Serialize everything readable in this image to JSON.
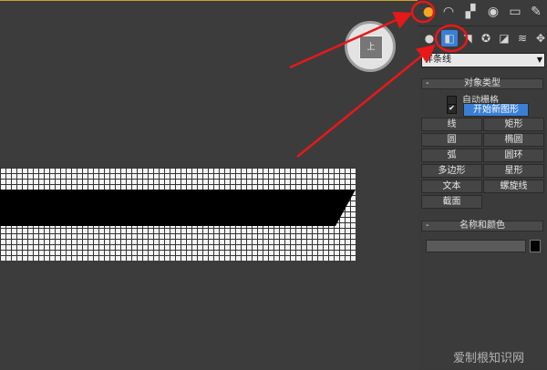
{
  "viewport": {
    "viewcube_label": "上"
  },
  "panel": {
    "tabs": [
      {
        "name": "create-tab",
        "glyph": "●"
      },
      {
        "name": "modify-tab",
        "glyph": "◠"
      },
      {
        "name": "hierarchy-tab",
        "glyph": "▞"
      },
      {
        "name": "motion-tab",
        "glyph": "◉"
      },
      {
        "name": "display-tab",
        "glyph": "▭"
      },
      {
        "name": "utilities-tab",
        "glyph": "✎"
      }
    ],
    "subcategories": [
      {
        "name": "geometry",
        "glyph": "●"
      },
      {
        "name": "shapes",
        "glyph": "◧"
      },
      {
        "name": "lights",
        "glyph": "◥"
      },
      {
        "name": "cameras",
        "glyph": "✪"
      },
      {
        "name": "helpers",
        "glyph": "◪"
      },
      {
        "name": "space-warps",
        "glyph": "≋"
      },
      {
        "name": "systems",
        "glyph": "✥"
      }
    ],
    "category_dropdown": "样条线",
    "object_type": {
      "header": "对象类型",
      "auto_grid": "自动栅格",
      "start_new_shape": "开始新图形",
      "buttons": [
        "线",
        "矩形",
        "圆",
        "椭圆",
        "弧",
        "圆环",
        "多边形",
        "星形",
        "文本",
        "螺旋线",
        "截面"
      ]
    },
    "name_and_color": {
      "header": "名称和颜色",
      "name_value": ""
    },
    "rollout_minus": "-"
  },
  "watermark": "爱制根知识网",
  "colors": {
    "annotation": "#e81818",
    "selection_highlight": "#3a7fd5"
  }
}
